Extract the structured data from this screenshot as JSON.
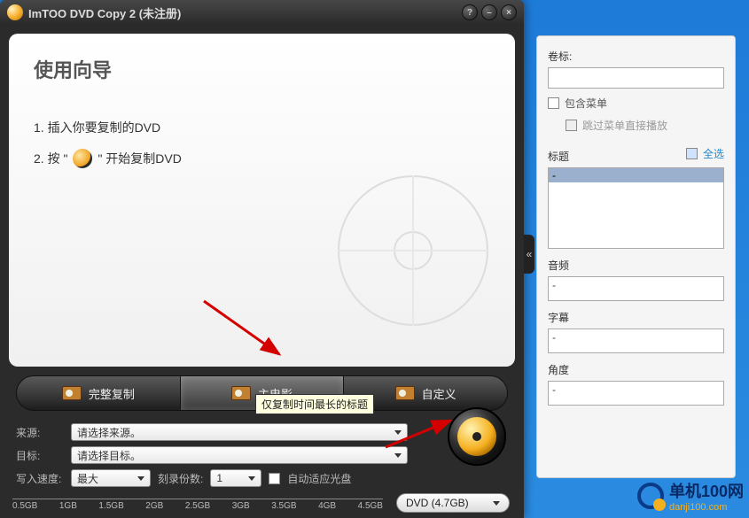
{
  "titlebar": {
    "title": "ImTOO DVD Copy 2 (未注册)"
  },
  "wizard": {
    "heading": "使用向导",
    "step1": "1. 插入你要复制的DVD",
    "step2_prefix": "2. 按 \"",
    "step2_suffix": "\" 开始复制DVD"
  },
  "modes": {
    "full": "完整复制",
    "main": "主电影",
    "custom": "自定义",
    "tooltip": "仅复制时间最长的标题"
  },
  "form": {
    "source_label": "来源:",
    "source_value": "请选择来源。",
    "target_label": "目标:",
    "target_value": "请选择目标。",
    "speed_label": "写入速度:",
    "speed_value": "最大",
    "copies_label": "刻录份数:",
    "copies_value": "1",
    "autofit_label": "自动适应光盘"
  },
  "ruler": {
    "t0": "0.5GB",
    "t1": "1GB",
    "t2": "1.5GB",
    "t3": "2GB",
    "t4": "2.5GB",
    "t5": "3GB",
    "t6": "3.5GB",
    "t7": "4GB",
    "t8": "4.5GB"
  },
  "target_pill": "DVD (4.7GB)",
  "side": {
    "volume_label": "卷标:",
    "include_menu": "包含菜单",
    "skip_menu": "跳过菜单直接播放",
    "titles_label": "标题",
    "select_all": "全选",
    "title_item": "-",
    "audio_label": "音频",
    "audio_item": "-",
    "subtitle_label": "字幕",
    "subtitle_item": "-",
    "angle_label": "角度",
    "angle_item": "-"
  },
  "watermark": {
    "name": "单机100网",
    "url": "danji100.com"
  }
}
